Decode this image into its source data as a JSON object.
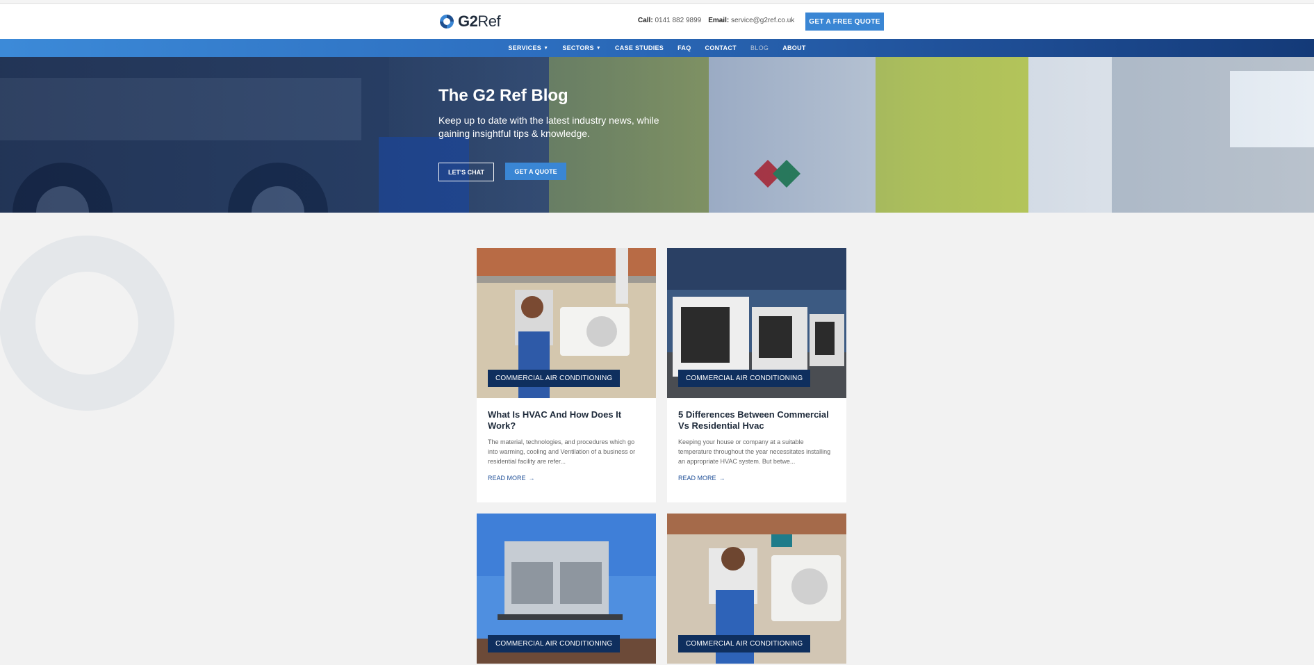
{
  "header": {
    "logo_text": "G2",
    "logo_text_2": "Ref",
    "call_label": "Call:",
    "call_value": "0141 882 9899",
    "email_label": "Email:",
    "email_value": "service@g2ref.co.uk",
    "cta_label": "GET A FREE QUOTE"
  },
  "nav": {
    "items": [
      {
        "label": "SERVICES"
      },
      {
        "label": "SECTORS"
      },
      {
        "label": "CASE STUDIES"
      },
      {
        "label": "FAQ"
      },
      {
        "label": "CONTACT"
      },
      {
        "label": "BLOG"
      },
      {
        "label": "ABOUT"
      }
    ]
  },
  "hero": {
    "title": "The G2 Ref Blog",
    "subtitle": "Keep up to date with the latest industry news, while gaining insightful tips & knowledge.",
    "btn_chat": "LET'S CHAT",
    "btn_quote": "GET A QUOTE"
  },
  "posts": [
    {
      "tag": "COMMERCIAL AIR CONDITIONING",
      "title": "What Is HVAC And How Does It Work?",
      "excerpt": "The material, technologies, and procedures which go into warming, cooling and Ventilation of a business or residential facility are refer...",
      "read_more": "READ MORE"
    },
    {
      "tag": "COMMERCIAL AIR CONDITIONING",
      "title": "5 Differences Between Commercial Vs Residential Hvac",
      "excerpt": "Keeping your house or company at a suitable temperature throughout the year necessitates installing an appropriate HVAC system. But betwe...",
      "read_more": "READ MORE"
    },
    {
      "tag": "COMMERCIAL AIR CONDITIONING"
    },
    {
      "tag": "COMMERCIAL AIR CONDITIONING"
    }
  ],
  "colors": {
    "accent": "#3a86d4",
    "navy": "#0f2f5e"
  }
}
